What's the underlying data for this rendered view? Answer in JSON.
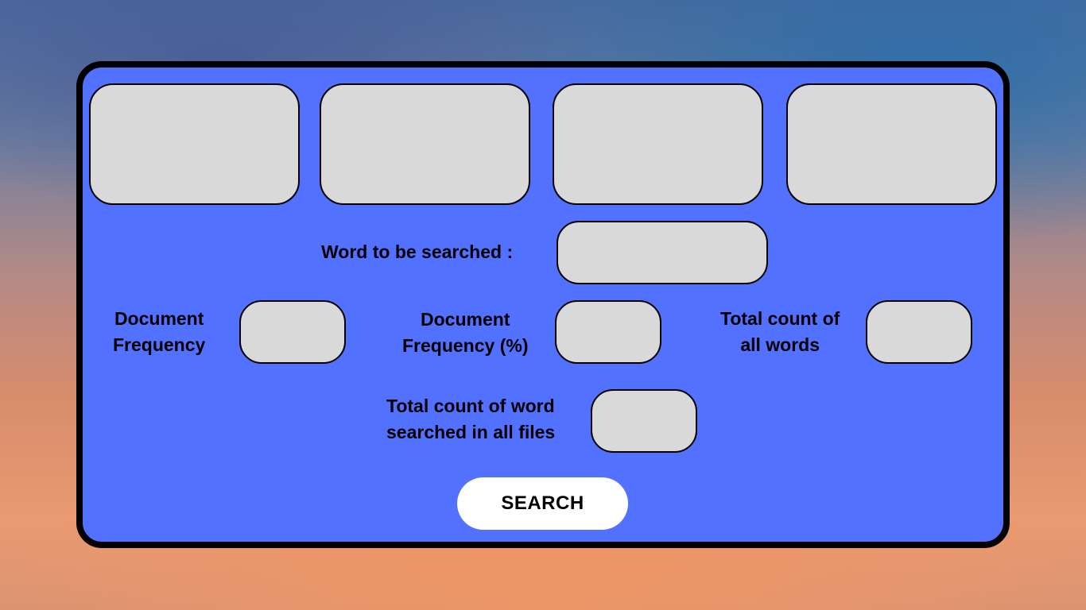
{
  "form": {
    "word_label": "Word to be searched :",
    "doc_freq_label_line1": "Document",
    "doc_freq_label_line2": "Frequency",
    "doc_freq_pct_label_line1": "Document",
    "doc_freq_pct_label_line2": "Frequency (%)",
    "total_words_label_line1": "Total count of",
    "total_words_label_line2": "all words",
    "total_searched_label_line1": "Total count of word",
    "total_searched_label_line2": "searched in all files",
    "search_button": "SEARCH"
  },
  "colors": {
    "panel": "#5271ff",
    "field": "#d9d9d9",
    "button": "#ffffff"
  }
}
